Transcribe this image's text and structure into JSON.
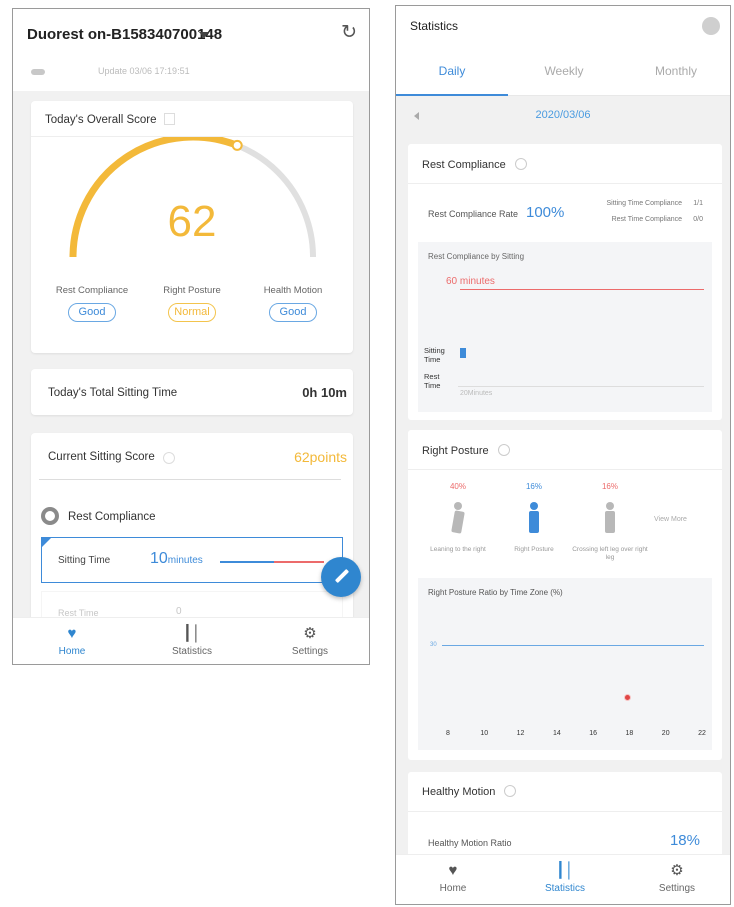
{
  "colors": {
    "accent_blue": "#3e8bd9",
    "score_yellow": "#f3b93a",
    "limit_red": "#ec6b6b",
    "good_badge": "#6aa8e3",
    "normal_badge": "#f3c44d"
  },
  "home": {
    "device_title": "Duorest on-B158340700148",
    "update_text": "Update 03/06 17:19:51",
    "overall_score": {
      "title": "Today's Overall Score",
      "value": "62",
      "gauge_fraction": 0.62,
      "levels": [
        {
          "label": "Rest Compliance",
          "badge": "Good"
        },
        {
          "label": "Right Posture",
          "badge": "Normal"
        },
        {
          "label": "Health Motion",
          "badge": "Good"
        }
      ]
    },
    "total_sitting": {
      "label": "Today's Total Sitting Time",
      "value": "0h 10m"
    },
    "current_score": {
      "label": "Current Sitting  Score",
      "value": "62points"
    },
    "rest_compliance": {
      "label": "Rest Compliance",
      "sitting_time_label": "Sitting Time",
      "sitting_time_value": "10",
      "sitting_time_unit": "minutes",
      "rest_time_label": "Rest Time",
      "rest_time_value": "0"
    }
  },
  "tabbar": {
    "home": "Home",
    "statistics": "Statistics",
    "settings": "Settings"
  },
  "stats": {
    "title": "Statistics",
    "tabs": [
      "Daily",
      "Weekly",
      "Monthly"
    ],
    "active_tab": "Daily",
    "date": "2020/03/06",
    "rest_compliance": {
      "title": "Rest Compliance",
      "rate_label": "Rest Compliance Rate",
      "rate_value": "100%",
      "sitting_time_compliance_label": "Sitting Time Compliance",
      "sitting_time_compliance_value": "1/1",
      "rest_time_compliance_label": "Rest Time Compliance",
      "rest_time_compliance_value": "0/0",
      "by_sitting_title": "Rest Compliance by Sitting",
      "limit_label": "60 minutes",
      "sitting_label": "Sitting Time",
      "rest_label": "Rest Time",
      "axis_label": "20Minutes"
    },
    "right_posture": {
      "title": "Right Posture",
      "items": [
        {
          "pct": "40%",
          "label": "Leaning to the right"
        },
        {
          "pct": "16%",
          "label": "Right Posture"
        },
        {
          "pct": "16%",
          "label": "Crossing left leg over right leg"
        }
      ],
      "view_more": "View More",
      "ratio_title": "Right Posture Ratio by Time Zone (%)",
      "ref_line_label": "30",
      "x_ticks": [
        "8",
        "10",
        "12",
        "14",
        "16",
        "18",
        "20",
        "22"
      ]
    },
    "healthy_motion": {
      "title": "Healthy Motion",
      "ratio_label": "Healthy Motion Ratio",
      "ratio_value": "18%"
    }
  },
  "chart_data": {
    "type": "scatter",
    "title": "Right Posture Ratio by Time Zone (%)",
    "x_ticks": [
      8,
      10,
      12,
      14,
      16,
      18,
      20,
      22
    ],
    "xlim": [
      8,
      22
    ],
    "reference_line": {
      "y": 30
    },
    "series": [
      {
        "x": [
          18
        ],
        "y": [
          10
        ]
      }
    ],
    "ylim": [
      0,
      40
    ]
  }
}
